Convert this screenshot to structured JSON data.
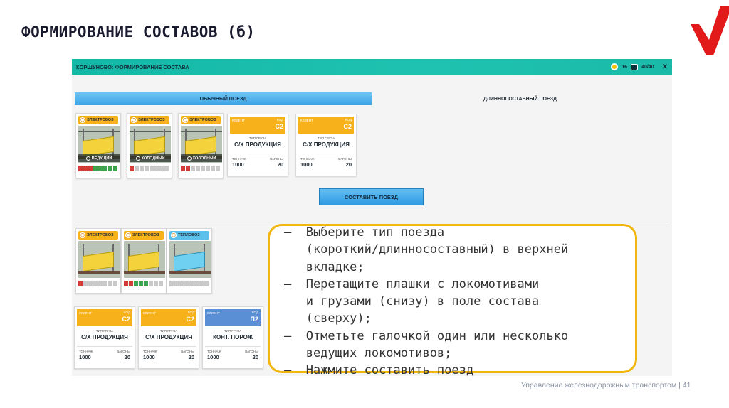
{
  "slide": {
    "title": "ФОРМИРОВАНИЕ СОСТАВОВ (б)",
    "footer": "Управление железнодорожным транспортом | 41",
    "logo_color": "#e21a1a"
  },
  "app": {
    "title": "КОРШУНОВО: ФОРМИРОВАНИЕ СОСТАВА",
    "coins": "16",
    "capacity": "40/40",
    "close_icon": "close-icon",
    "accent": "#1fc2b0"
  },
  "tabs": [
    {
      "label": "ОБЫЧНЫЙ ПОЕЗД",
      "active": true
    },
    {
      "label": "ДЛИННОСОСТАВНЫЙ ПОЕЗД",
      "active": false
    }
  ],
  "composition": {
    "locomotives": [
      {
        "type": "ЭЛЕКТРОВОЗ",
        "role": "ВЕДУЩИЙ",
        "bars": [
          "red",
          "red",
          "red",
          "green",
          "green",
          "green",
          "green",
          "green"
        ]
      },
      {
        "type": "ЭЛЕКТРОВОЗ",
        "role": "ХОЛОДНЫЙ",
        "bars": [
          "red",
          "gray",
          "gray",
          "gray",
          "gray",
          "gray",
          "gray",
          "gray"
        ]
      },
      {
        "type": "ЭЛЕКТРОВОЗ",
        "role": "ХОЛОДНЫЙ",
        "bars": [
          "red",
          "red",
          "gray",
          "gray",
          "gray",
          "gray",
          "gray",
          "gray"
        ]
      }
    ],
    "cargo": [
      {
        "class_label": "КЛИЕНТ",
        "code_label": "КОД",
        "code": "С2",
        "type_label": "ТИП ГРУЗА",
        "type": "С/Х ПРОДУКЦИЯ",
        "tonnage_label": "ТОННАЖ",
        "tonnage": "1000",
        "wagons_label": "ВАГОНЫ",
        "wagons": "20"
      },
      {
        "class_label": "КЛИЕНТ",
        "code_label": "КОД",
        "code": "С2",
        "type_label": "ТИП ГРУЗА",
        "type": "С/Х ПРОДУКЦИЯ",
        "tonnage_label": "ТОННАЖ",
        "tonnage": "1000",
        "wagons_label": "ВАГОНЫ",
        "wagons": "20"
      }
    ],
    "compose_button": "СОСТАВИТЬ ПОЕЗД"
  },
  "pool": {
    "locomotives": [
      {
        "type": "ЭЛЕКТРОВОЗ",
        "color": "orange",
        "bars": [
          "red",
          "gray",
          "gray",
          "gray",
          "gray",
          "gray",
          "gray",
          "gray"
        ]
      },
      {
        "type": "ЭЛЕКТРОВОЗ",
        "color": "orange",
        "bars": [
          "red",
          "red",
          "green",
          "green",
          "green",
          "gray",
          "gray",
          "gray"
        ]
      },
      {
        "type": "ТЕПЛОВОЗ",
        "color": "blue",
        "bars": [
          "gray",
          "gray",
          "gray",
          "gray",
          "gray",
          "gray",
          "gray",
          "gray"
        ]
      }
    ],
    "cargo": [
      {
        "class_label": "КЛИЕНТ",
        "code_label": "КОД",
        "code": "С2",
        "type_label": "ТИП ГРУЗА",
        "type": "С/Х ПРОДУКЦИЯ",
        "tonnage_label": "ТОННАЖ",
        "tonnage": "1000",
        "wagons_label": "ВАГОНЫ",
        "wagons": "20"
      },
      {
        "class_label": "КЛИЕНТ",
        "code_label": "КОД",
        "code": "С2",
        "type_label": "ТИП ГРУЗА",
        "type": "С/Х ПРОДУКЦИЯ",
        "tonnage_label": "ТОННАЖ",
        "tonnage": "1000",
        "wagons_label": "ВАГОНЫ",
        "wagons": "20"
      },
      {
        "class_label": "КЛИЕНТ",
        "code_label": "КОД",
        "code": "П2",
        "type_label": "ТИП ГРУЗА",
        "type": "КОНТ. ПОРОЖ",
        "tonnage_label": "ТОННАЖ",
        "tonnage": "1000",
        "wagons_label": "ВАГОНЫ",
        "wagons": "20"
      }
    ]
  },
  "instructions": "–  Выберите тип поезда\n   (короткий/длинносоставный) в верхней\n   вкладке;\n–  Перетащите плашки с локомотивами\n   и грузами (снизу) в поле состава\n   (сверху);\n–  Отметьте галочкой один или несколько\n   ведущих локомотивов;\n–  Нажмите составить поезд"
}
